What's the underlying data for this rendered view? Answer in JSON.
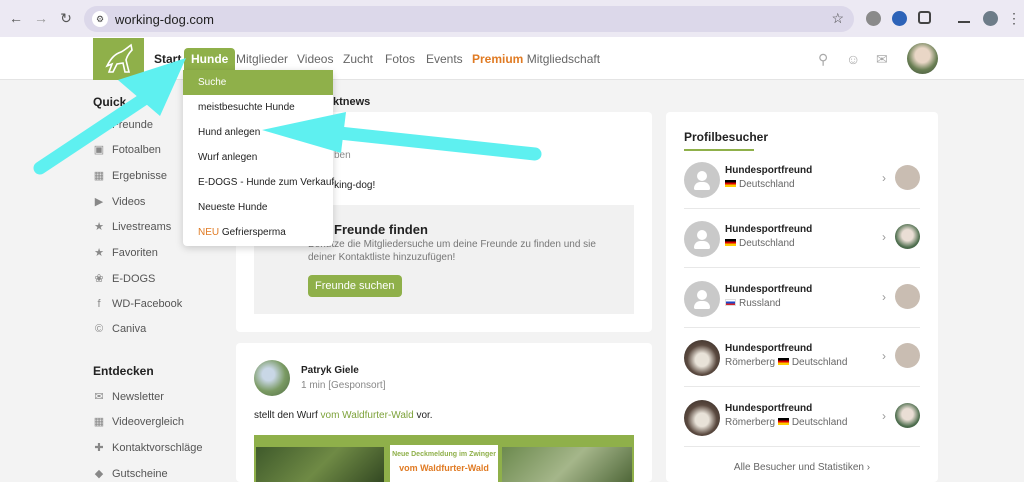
{
  "browser": {
    "url": "working-dog.com"
  },
  "nav": {
    "start": "Start",
    "hunde": "Hunde",
    "mitglieder": "Mitglieder",
    "videos": "Videos",
    "zucht": "Zucht",
    "fotos": "Fotos",
    "events": "Events",
    "premium": "Premium",
    "mitgliedschaft": "Mitgliedschaft"
  },
  "dropdown": {
    "items": [
      "Suche",
      "meistbesuchte Hunde",
      "Hund anlegen",
      "Wurf anlegen",
      "E-DOGS - Hunde zum Verkauf",
      "Neueste Hunde"
    ],
    "neu_badge": "NEU",
    "neu_label": "Gefriersperma"
  },
  "sidebar": {
    "quick_head": "Quick",
    "quick_items": [
      "Freunde",
      "Fotoalben",
      "Ergebnisse",
      "Videos",
      "Livestreams",
      "Favoriten",
      "E-DOGS",
      "WD-Facebook",
      "Caniva"
    ],
    "discover_head": "Entdecken",
    "discover_items": [
      "Newsletter",
      "Videovergleich",
      "Kontaktvorschläge",
      "Gutscheine"
    ]
  },
  "feed": {
    "section_title_fragment": "ktnews",
    "post1_time_fragment": "ben",
    "post1_text_fragment": "working-dog!",
    "promo_title_fragment": "Freunde finden",
    "promo_text": "Benutze die Mitgliedersuche um deine Freunde zu finden und sie deiner Kontaktliste hinzuzufügen!",
    "promo_button": "Freunde suchen",
    "post2_author": "Patryk Giele",
    "post2_time": "1 min [Gesponsort]",
    "post2_text_pre": "stellt den Wurf ",
    "post2_link": "vom Waldfurter-Wald",
    "post2_text_post": " vor.",
    "banner_line1": "Neue Deckmeldung im Zwinger",
    "banner_line2": "vom Waldfurter-Wald"
  },
  "visitors": {
    "title": "Profilbesucher",
    "rows": [
      {
        "name": "Hundesportfreund",
        "city": "",
        "country": "Deutschland",
        "flag": "de"
      },
      {
        "name": "Hundesportfreund",
        "city": "",
        "country": "Deutschland",
        "flag": "de"
      },
      {
        "name": "Hundesportfreund",
        "city": "",
        "country": "Russland",
        "flag": "ru"
      },
      {
        "name": "Hundesportfreund",
        "city": "Römerberg",
        "country": "Deutschland",
        "flag": "de"
      },
      {
        "name": "Hundesportfreund",
        "city": "Römerberg",
        "country": "Deutschland",
        "flag": "de"
      }
    ],
    "footer": "Alle Besucher und Statistiken"
  },
  "colors": {
    "accent": "#8fb04a",
    "premium": "#e07b24",
    "annotation_arrow": "#5ef0f0"
  }
}
